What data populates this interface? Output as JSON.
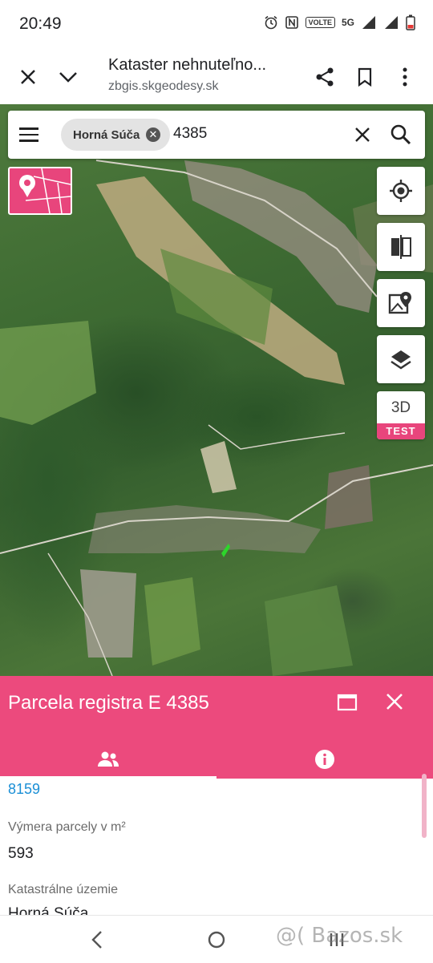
{
  "status_bar": {
    "time": "20:49",
    "icons": [
      "alarm-icon",
      "nfc-icon",
      "volte-icon",
      "signal-icon",
      "battery-icon"
    ],
    "volte": "VOLTE",
    "network": "5G"
  },
  "browser": {
    "title": "Kataster nehnuteľno...",
    "url": "zbgis.skgeodesy.sk"
  },
  "search": {
    "chip_label": "Horná Súča",
    "query": "4385"
  },
  "map_controls": {
    "threed_label": "3D",
    "threed_badge": "TEST"
  },
  "panel": {
    "title": "Parcela registra E 4385",
    "tabs": [
      "owners",
      "info"
    ],
    "partial_value": "8159",
    "fields": [
      {
        "label": "Výmera parcely v m²",
        "value": "593"
      },
      {
        "label": "Katastrálne územie",
        "value": "Horná Súča"
      }
    ]
  },
  "watermark": "@( Bazos.sk",
  "colors": {
    "accent": "#ec4a7d",
    "link": "#1a8fd6"
  }
}
